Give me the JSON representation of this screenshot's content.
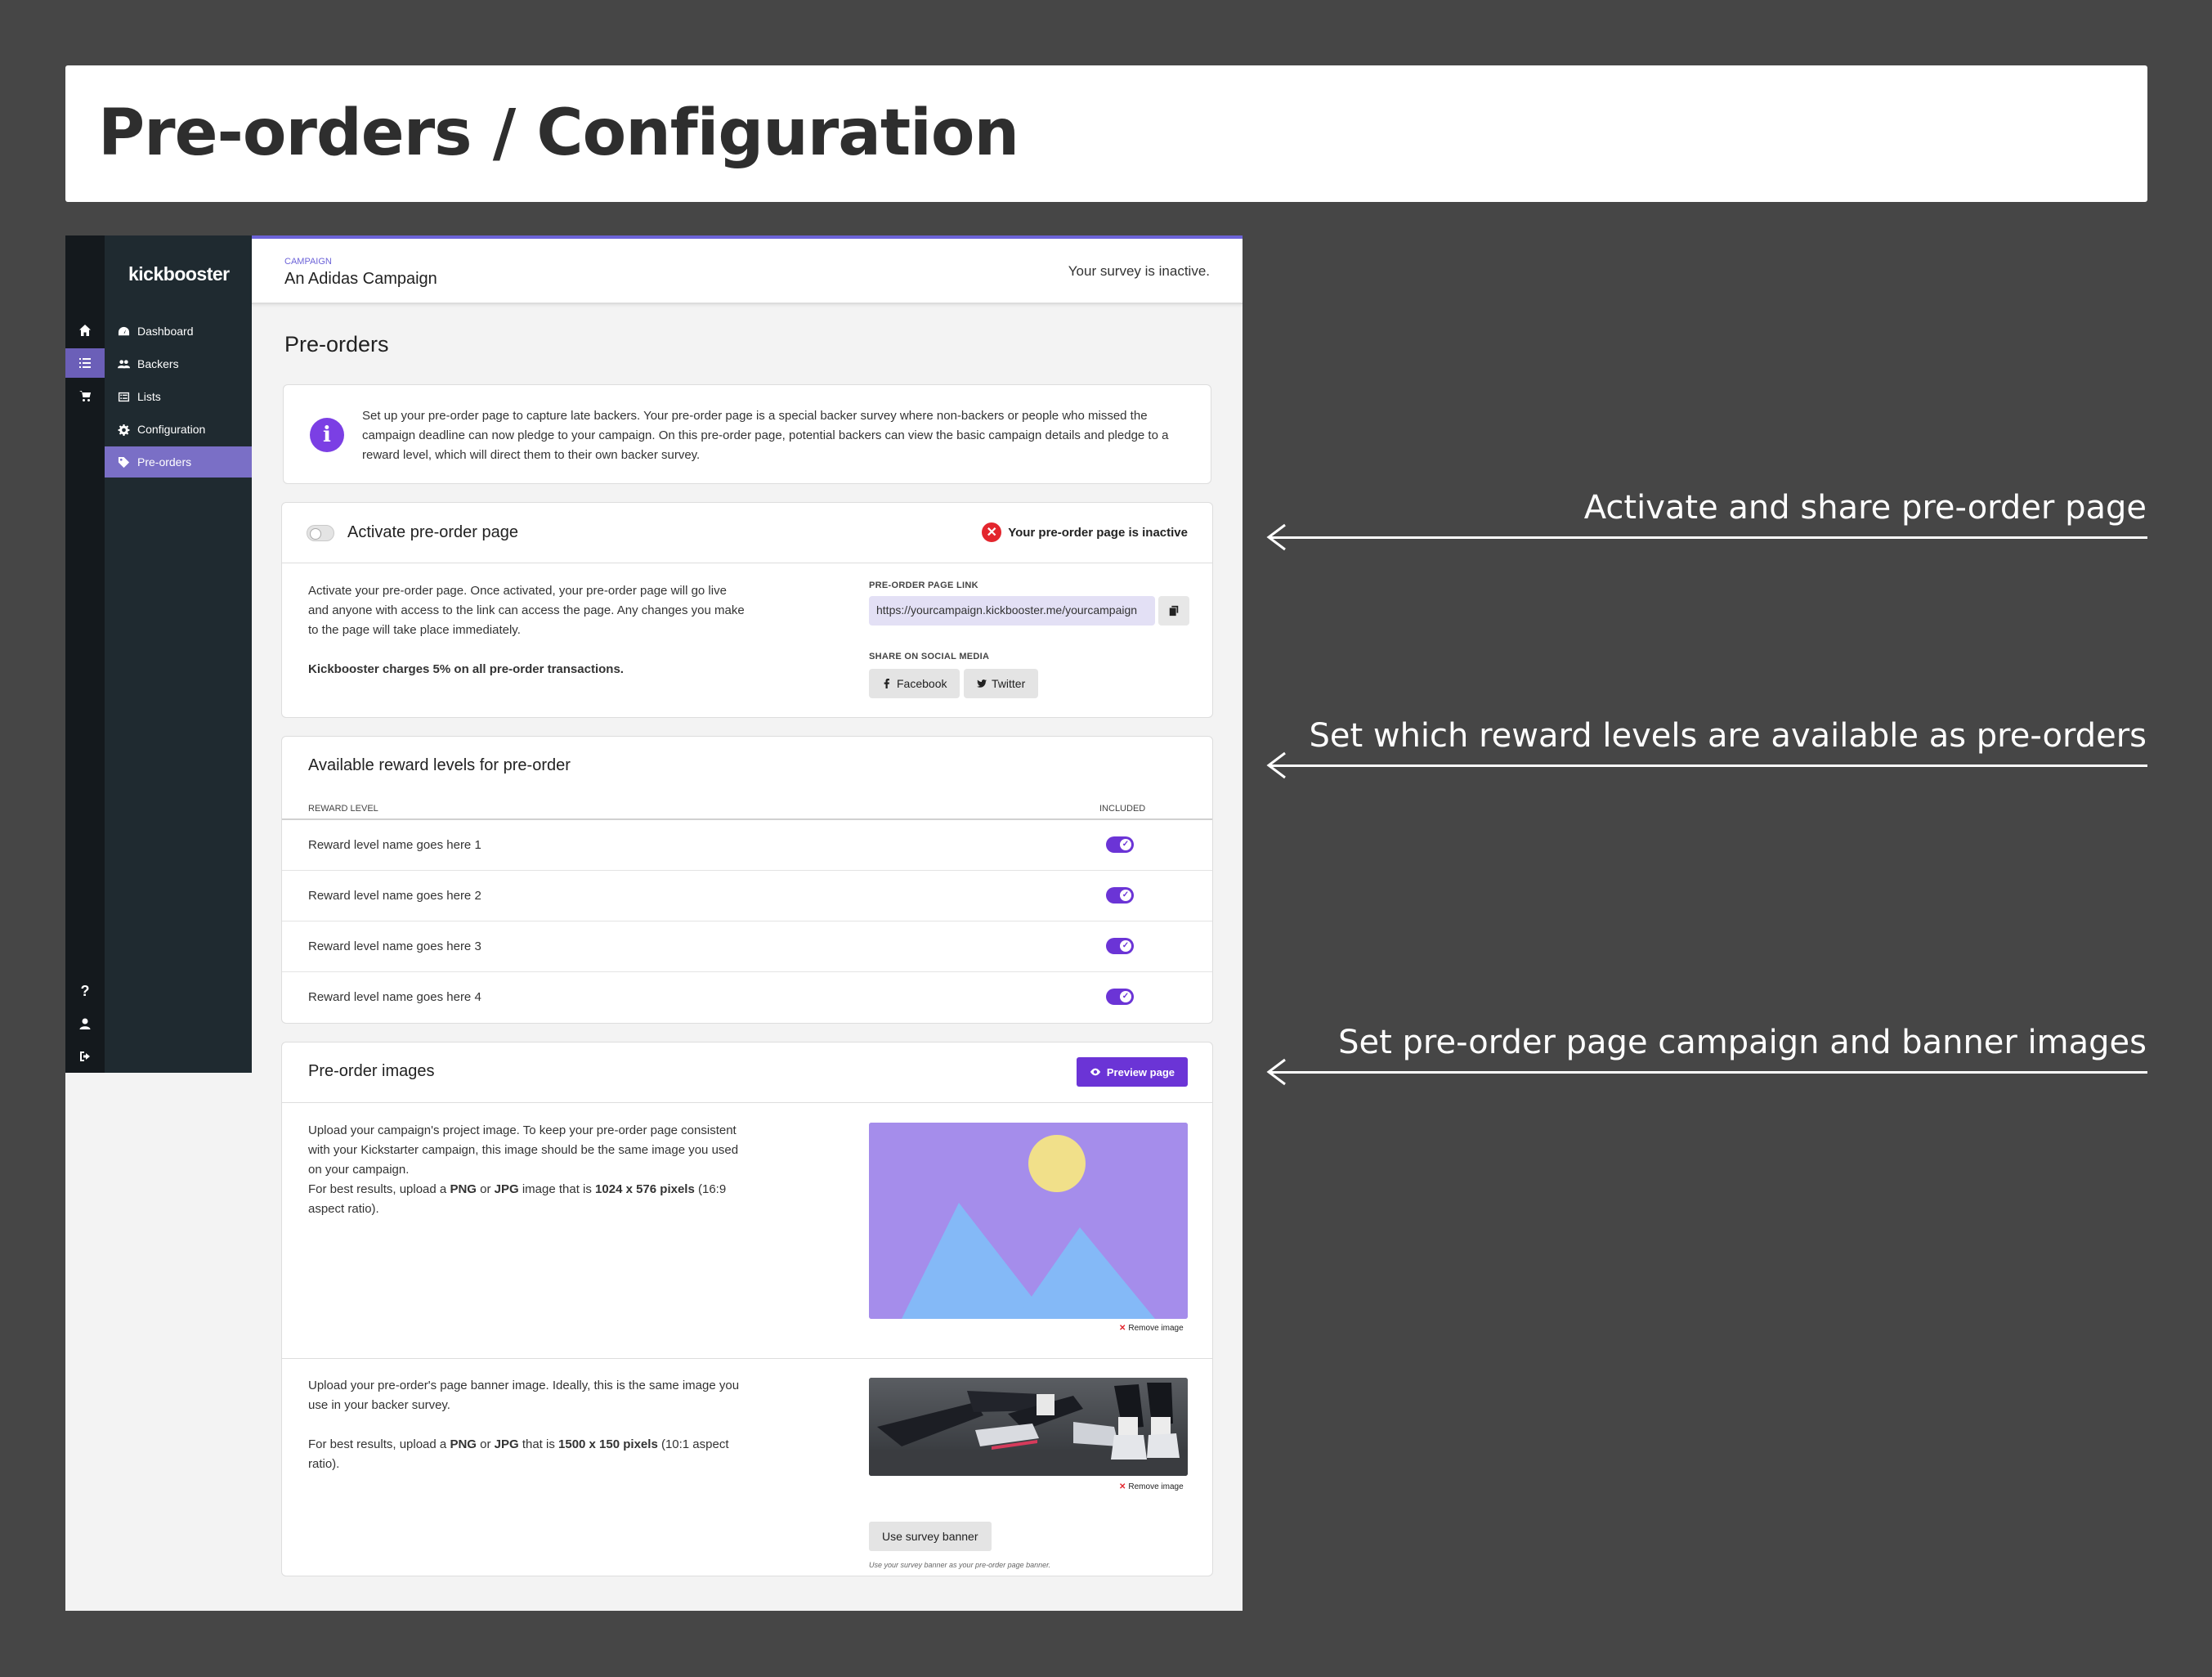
{
  "page_title": "Pre-orders / Configuration",
  "rail": {
    "icons": [
      "home-icon",
      "list-icon",
      "cart-icon",
      "help-icon",
      "user-icon",
      "logout-icon"
    ]
  },
  "sidebar": {
    "logo": "kickbooster",
    "items": [
      {
        "label": "Dashboard",
        "icon": "dashboard-icon"
      },
      {
        "label": "Backers",
        "icon": "users-icon"
      },
      {
        "label": "Lists",
        "icon": "list-icon"
      },
      {
        "label": "Configuration",
        "icon": "gear-icon"
      },
      {
        "label": "Pre-orders",
        "icon": "tag-icon"
      }
    ],
    "active_item": "Pre-orders"
  },
  "header": {
    "campaign_label": "CAMPAIGN",
    "campaign_name": "An Adidas Campaign",
    "survey_status": "Your survey is inactive."
  },
  "main": {
    "heading": "Pre-orders",
    "info_text": "Set up your pre-order page to capture late backers. Your pre-order page is a special backer survey where non-backers or people who missed the campaign deadline can now pledge to your campaign. On this pre-order page, potential backers can view the basic campaign details and pledge to a reward level, which will direct them to their own backer survey.",
    "activate": {
      "title": "Activate pre-order page",
      "toggle_on": false,
      "status": "Your pre-order page is inactive",
      "description": "Activate your pre-order page. Once activated, your pre-order page will go live and anyone with access to the link can access the page. Any changes you make to the page will take place immediately.",
      "fee_note": "Kickbooster charges 5% on all pre-order transactions.",
      "link_label": "PRE-ORDER PAGE LINK",
      "link_value": "https://yourcampaign.kickbooster.me/yourcampaign",
      "share_label": "SHARE ON SOCIAL MEDIA",
      "facebook_label": "Facebook",
      "twitter_label": "Twitter"
    },
    "rewards": {
      "title": "Available reward levels for pre-order",
      "col_level": "REWARD LEVEL",
      "col_included": "INCLUDED",
      "rows": [
        {
          "name": "Reward level name goes here 1",
          "included": true
        },
        {
          "name": "Reward level name goes here 2",
          "included": true
        },
        {
          "name": "Reward level name goes here 3",
          "included": true
        },
        {
          "name": "Reward level name goes here 4",
          "included": true
        }
      ]
    },
    "images": {
      "title": "Pre-order images",
      "preview_label": "Preview page",
      "project_desc_1": "Upload your campaign's project image. To keep your pre-order page consistent with your Kickstarter campaign, this image should be the same image you used on your campaign.",
      "project_desc_2_prefix": "For best results, upload a ",
      "png": "PNG",
      "or": " or ",
      "jpg": "JPG",
      "project_desc_2_mid": " image that is ",
      "project_size": "1024 x 576 pixels",
      "project_desc_2_suffix": " (16:9 aspect ratio).",
      "remove_label": "Remove image",
      "banner_desc_1": "Upload your pre-order's page banner image. Ideally, this is the same image you use in your backer survey.",
      "banner_desc_2_mid": " that is ",
      "banner_size": "1500 x 150 pixels",
      "banner_desc_2_suffix": " (10:1 aspect ratio).",
      "use_banner_label": "Use survey banner",
      "use_banner_note": "Use your survey banner as your pre-order page banner."
    }
  },
  "annotations": [
    "Activate and share pre-order page",
    "Set which reward levels are available as pre-orders",
    "Set pre-order page campaign and banner images"
  ],
  "colors": {
    "accent": "#6b34d6",
    "sidebar_active": "#7a6fc6",
    "danger": "#e3262e",
    "background": "#464646"
  }
}
